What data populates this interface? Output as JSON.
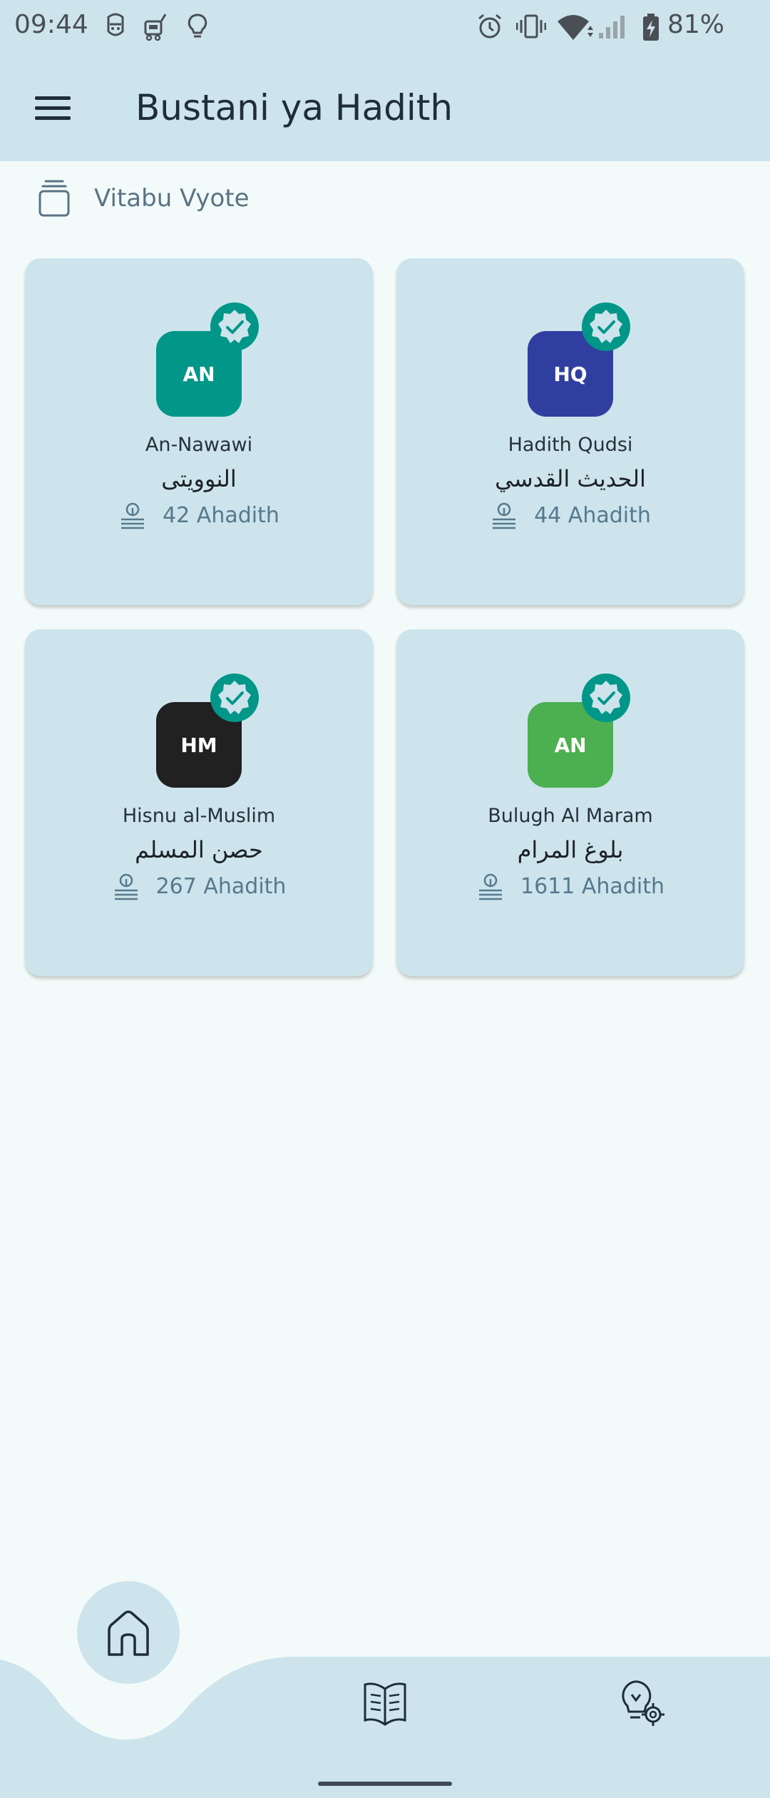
{
  "status_bar": {
    "time": "09:44",
    "battery_percent": "81%",
    "icons": [
      "face-notification-icon",
      "robot-notification-icon",
      "lightbulb-notification-icon",
      "alarm-icon",
      "vibrate-icon",
      "wifi-icon",
      "signal-icon",
      "battery-charging-icon"
    ]
  },
  "app_bar": {
    "title": "Bustani ya Hadith",
    "menu_icon": "hamburger-menu-icon"
  },
  "section": {
    "icon": "stacked-books-icon",
    "label": "Vitabu Vyote"
  },
  "books": [
    {
      "initials": "AN",
      "name": "An-Nawawi",
      "arabic": "النوويتى",
      "count": "42 Ahadith",
      "color": "#009688",
      "verified": true
    },
    {
      "initials": "HQ",
      "name": "Hadith Qudsi",
      "arabic": "الحديث القدسي",
      "count": "44 Ahadith",
      "color": "#303f9f",
      "verified": true
    },
    {
      "initials": "HM",
      "name": "Hisnu al-Muslim",
      "arabic": "حصن المسلم",
      "count": "267 Ahadith",
      "color": "#212121",
      "verified": true
    },
    {
      "initials": "AN",
      "name": "Bulugh Al Maram",
      "arabic": "بلوغ المرام",
      "count": "1611 Ahadith",
      "color": "#4caf50",
      "verified": true
    }
  ],
  "bottom_nav": {
    "items": [
      {
        "icon": "home-icon",
        "active": true
      },
      {
        "icon": "open-book-icon",
        "active": false
      },
      {
        "icon": "lightbulb-settings-icon",
        "active": false
      }
    ]
  },
  "colors": {
    "bar_background": "#cde4ed",
    "page_background": "#f2fbf9",
    "verified_badge": "#009688"
  }
}
